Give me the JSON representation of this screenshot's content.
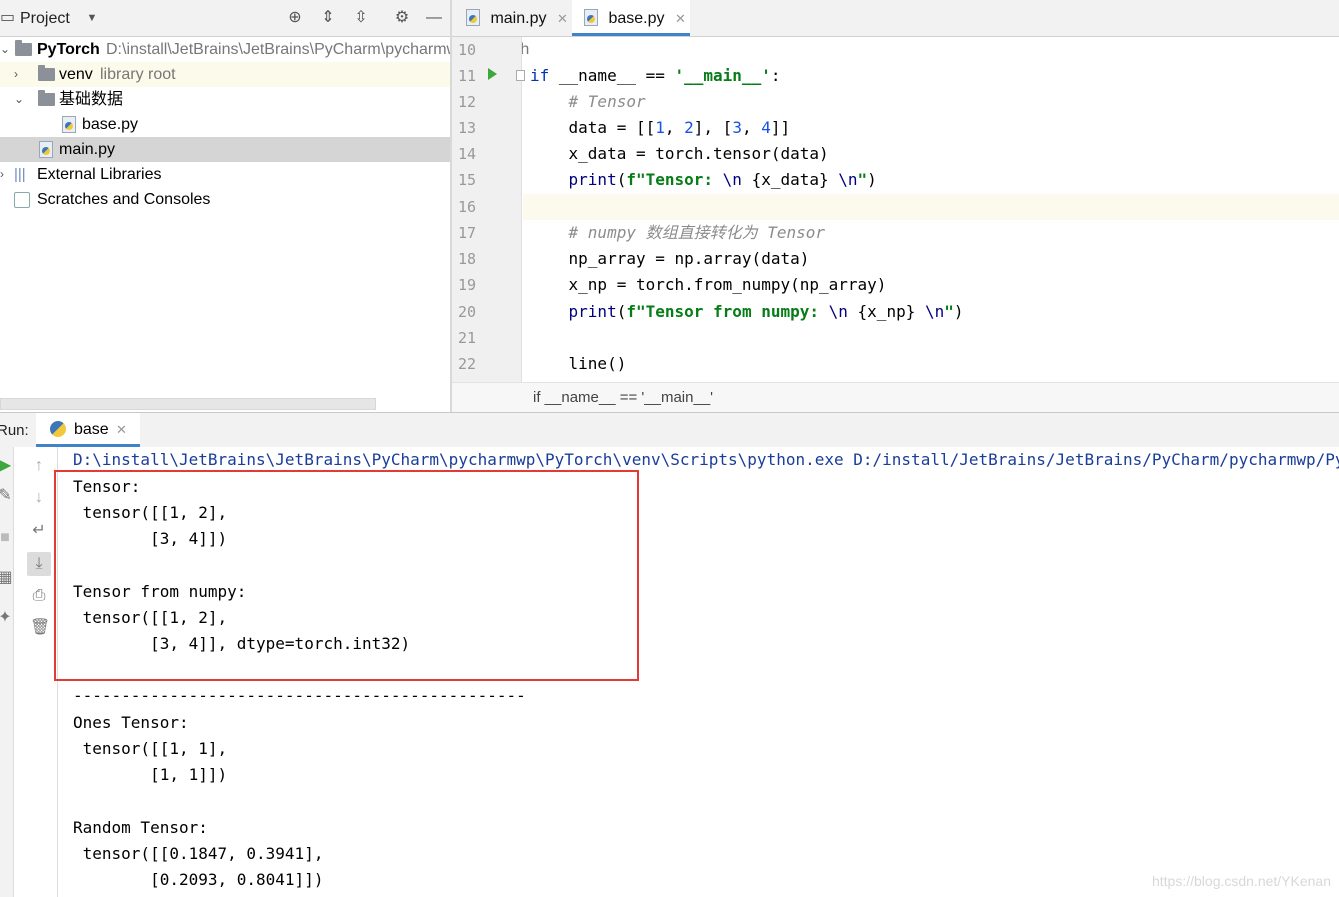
{
  "project": {
    "title": "Project",
    "tree": [
      {
        "label": "PyTorch",
        "note": "D:\\install\\JetBrains\\JetBrains\\PyCharm\\pycharmwp\\PyTorch"
      },
      {
        "label": "venv",
        "note": "library root"
      },
      {
        "label": "基础数据",
        "note": ""
      },
      {
        "label": "base.py",
        "note": ""
      },
      {
        "label": "main.py",
        "note": ""
      },
      {
        "label": "External Libraries",
        "note": ""
      },
      {
        "label": "Scratches and Consoles",
        "note": ""
      }
    ]
  },
  "editor": {
    "tabs": [
      {
        "label": "main.py",
        "active": false
      },
      {
        "label": "base.py",
        "active": true
      }
    ],
    "line_numbers": [
      "10",
      "11",
      "12",
      "13",
      "14",
      "15",
      "16",
      "17",
      "18",
      "19",
      "20",
      "21",
      "22"
    ],
    "breadcrumb": "if __name__ == '__main__'"
  },
  "run": {
    "label": "Run:",
    "tab": "base",
    "command": "D:\\install\\JetBrains\\JetBrains\\PyCharm\\pycharmwp\\PyTorch\\venv\\Scripts\\python.exe D:/install/JetBrains/JetBrains/PyCharm/pycharmwp/PyTorch/基础数据/base.py",
    "output": [
      "Tensor:",
      " tensor([[1, 2],",
      "        [3, 4]])",
      "",
      "Tensor from numpy:",
      " tensor([[1, 2],",
      "        [3, 4]], dtype=torch.int32)",
      "",
      "-----------------------------------------------",
      "Ones Tensor:",
      " tensor([[1, 1],",
      "        [1, 1]])",
      "",
      "Random Tensor:",
      " tensor([[0.1847, 0.3941],",
      "        [0.2093, 0.8041]])"
    ]
  },
  "watermark": "https://blog.csdn.net/YKenan",
  "colors": {
    "accent": "#4083c9",
    "highlight_box": "#e53935",
    "run_green": "#3ea63e"
  }
}
